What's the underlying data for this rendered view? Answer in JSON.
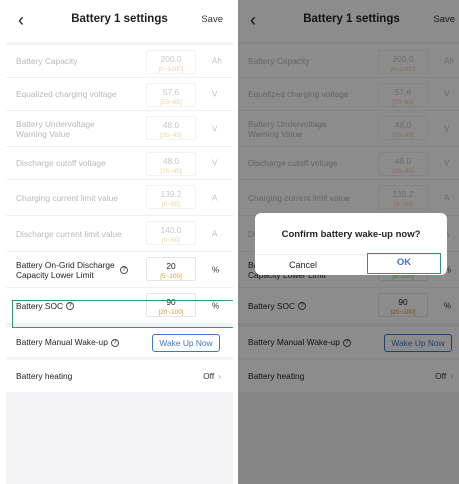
{
  "header": {
    "title": "Battery 1 settings",
    "save_label": "Save"
  },
  "rows": [
    {
      "label": "Battery Capacity",
      "value": "200.0",
      "range": "[0~1000]",
      "unit": "Ah",
      "enabled": false
    },
    {
      "label": "Equalized charging voltage",
      "value": "57.6",
      "range": "[55~65]",
      "unit": "V",
      "enabled": false
    },
    {
      "label": "Battery Undervoltage Warning Value",
      "value": "48.0",
      "range": "[35~45]",
      "unit": "V",
      "enabled": false
    },
    {
      "label": "Discharge cutoff voltage",
      "value": "48.0",
      "range": "[35~45]",
      "unit": "V",
      "enabled": false
    },
    {
      "label": "Charging current limit value",
      "value": "139.2",
      "range": "[0~50]",
      "unit": "A",
      "enabled": false
    },
    {
      "label": "Discharge current limit value",
      "value": "140.0",
      "range": "[0~50]",
      "unit": "A",
      "enabled": false
    },
    {
      "label": "Battery On-Grid Discharge Capacity Lower Limit",
      "value": "20",
      "range": "[5~100]",
      "unit": "%",
      "enabled": true
    },
    {
      "label": "Battery SOC",
      "value": "90",
      "range": "[20~100]",
      "unit": "%",
      "enabled": true
    }
  ],
  "wake_up": {
    "label": "Battery Manual Wake-up",
    "button_label": "Wake Up Now"
  },
  "heating": {
    "label": "Battery heating",
    "value": "Off"
  },
  "dialog": {
    "title": "Confirm battery wake-up now?",
    "cancel_label": "Cancel",
    "ok_label": "OK"
  },
  "icons": {
    "back": "chevron-left-icon",
    "help": "question-circle-icon",
    "chevron": "chevron-right-icon"
  },
  "colors": {
    "accent_blue": "#3d77c9",
    "highlight_green": "#2f9a6a",
    "range_orange": "#d39a2a"
  }
}
